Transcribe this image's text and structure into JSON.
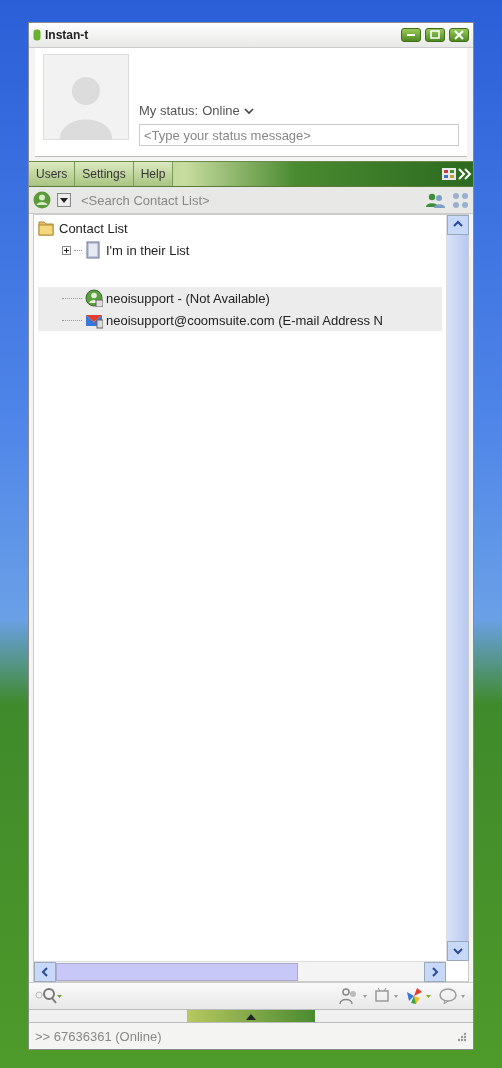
{
  "window": {
    "title": "Instan-t"
  },
  "profile": {
    "status_label": "My status:",
    "status_value": "Online",
    "status_message": {
      "placeholder": "<Type your status message>"
    }
  },
  "menu": [
    {
      "label": "Users"
    },
    {
      "label": "Settings"
    },
    {
      "label": "Help"
    }
  ],
  "search": {
    "placeholder": "<Search Contact List>"
  },
  "tree": [
    {
      "label": "Contact List",
      "kind": "folder",
      "selected": false,
      "children": [
        {
          "label": "I'm in their List",
          "kind": "group",
          "expanded": false,
          "selected": false
        },
        {
          "label": "neoisupport - (Not Available)",
          "kind": "im-contact",
          "selected": true
        },
        {
          "label": "neoisupport@coomsuite.com (E-mail Address N",
          "kind": "email-contact",
          "selected": true
        }
      ]
    }
  ],
  "zoom_slider": {
    "level": 0.5
  },
  "status_bar": {
    "text": ">> 67636361 (Online)"
  }
}
